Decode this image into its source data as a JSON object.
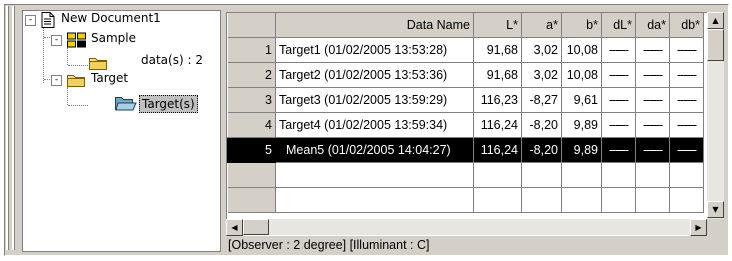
{
  "tree": {
    "root": {
      "label": "New Document1",
      "icon": "document-icon",
      "expander": "-"
    },
    "sample": {
      "label": "Sample",
      "icon": "sample-icon",
      "expander": "-"
    },
    "sample_child": {
      "label": "data(s) : 2",
      "icon": "folder-icon"
    },
    "target": {
      "label": "Target",
      "icon": "folder-icon",
      "expander": "-"
    },
    "target_child": {
      "label": "Target(s)",
      "icon": "folder-open-icon"
    }
  },
  "grid": {
    "columns": [
      "",
      "Data Name",
      "L*",
      "a*",
      "b*",
      "dL*",
      "da*",
      "db*"
    ],
    "rows": [
      {
        "n": "1",
        "name": "Target1 (01/02/2005 13:53:28)",
        "L": "91,68",
        "a": "3,02",
        "b": "10,08",
        "dL": "------",
        "da": "------",
        "db": "------"
      },
      {
        "n": "2",
        "name": "Target2 (01/02/2005 13:53:36)",
        "L": "91,68",
        "a": "3,02",
        "b": "10,08",
        "dL": "------",
        "da": "------",
        "db": "------"
      },
      {
        "n": "3",
        "name": "Target3 (01/02/2005 13:59:29)",
        "L": "116,23",
        "a": "-8,27",
        "b": "9,61",
        "dL": "------",
        "da": "------",
        "db": "------"
      },
      {
        "n": "4",
        "name": "Target4 (01/02/2005 13:59:34)",
        "L": "116,24",
        "a": "-8,20",
        "b": "9,89",
        "dL": "------",
        "da": "------",
        "db": "------"
      },
      {
        "n": "5",
        "name": "Mean5 (01/02/2005 14:04:27)",
        "L": "116,24",
        "a": "-8,20",
        "b": "9,89",
        "dL": "------",
        "da": "------",
        "db": "------"
      }
    ],
    "selected_row": 5
  },
  "status": "[Observer : 2 degree]  [Illuminant : C]",
  "colors": {
    "selection": "#000000",
    "face": "#d4d0c8"
  }
}
